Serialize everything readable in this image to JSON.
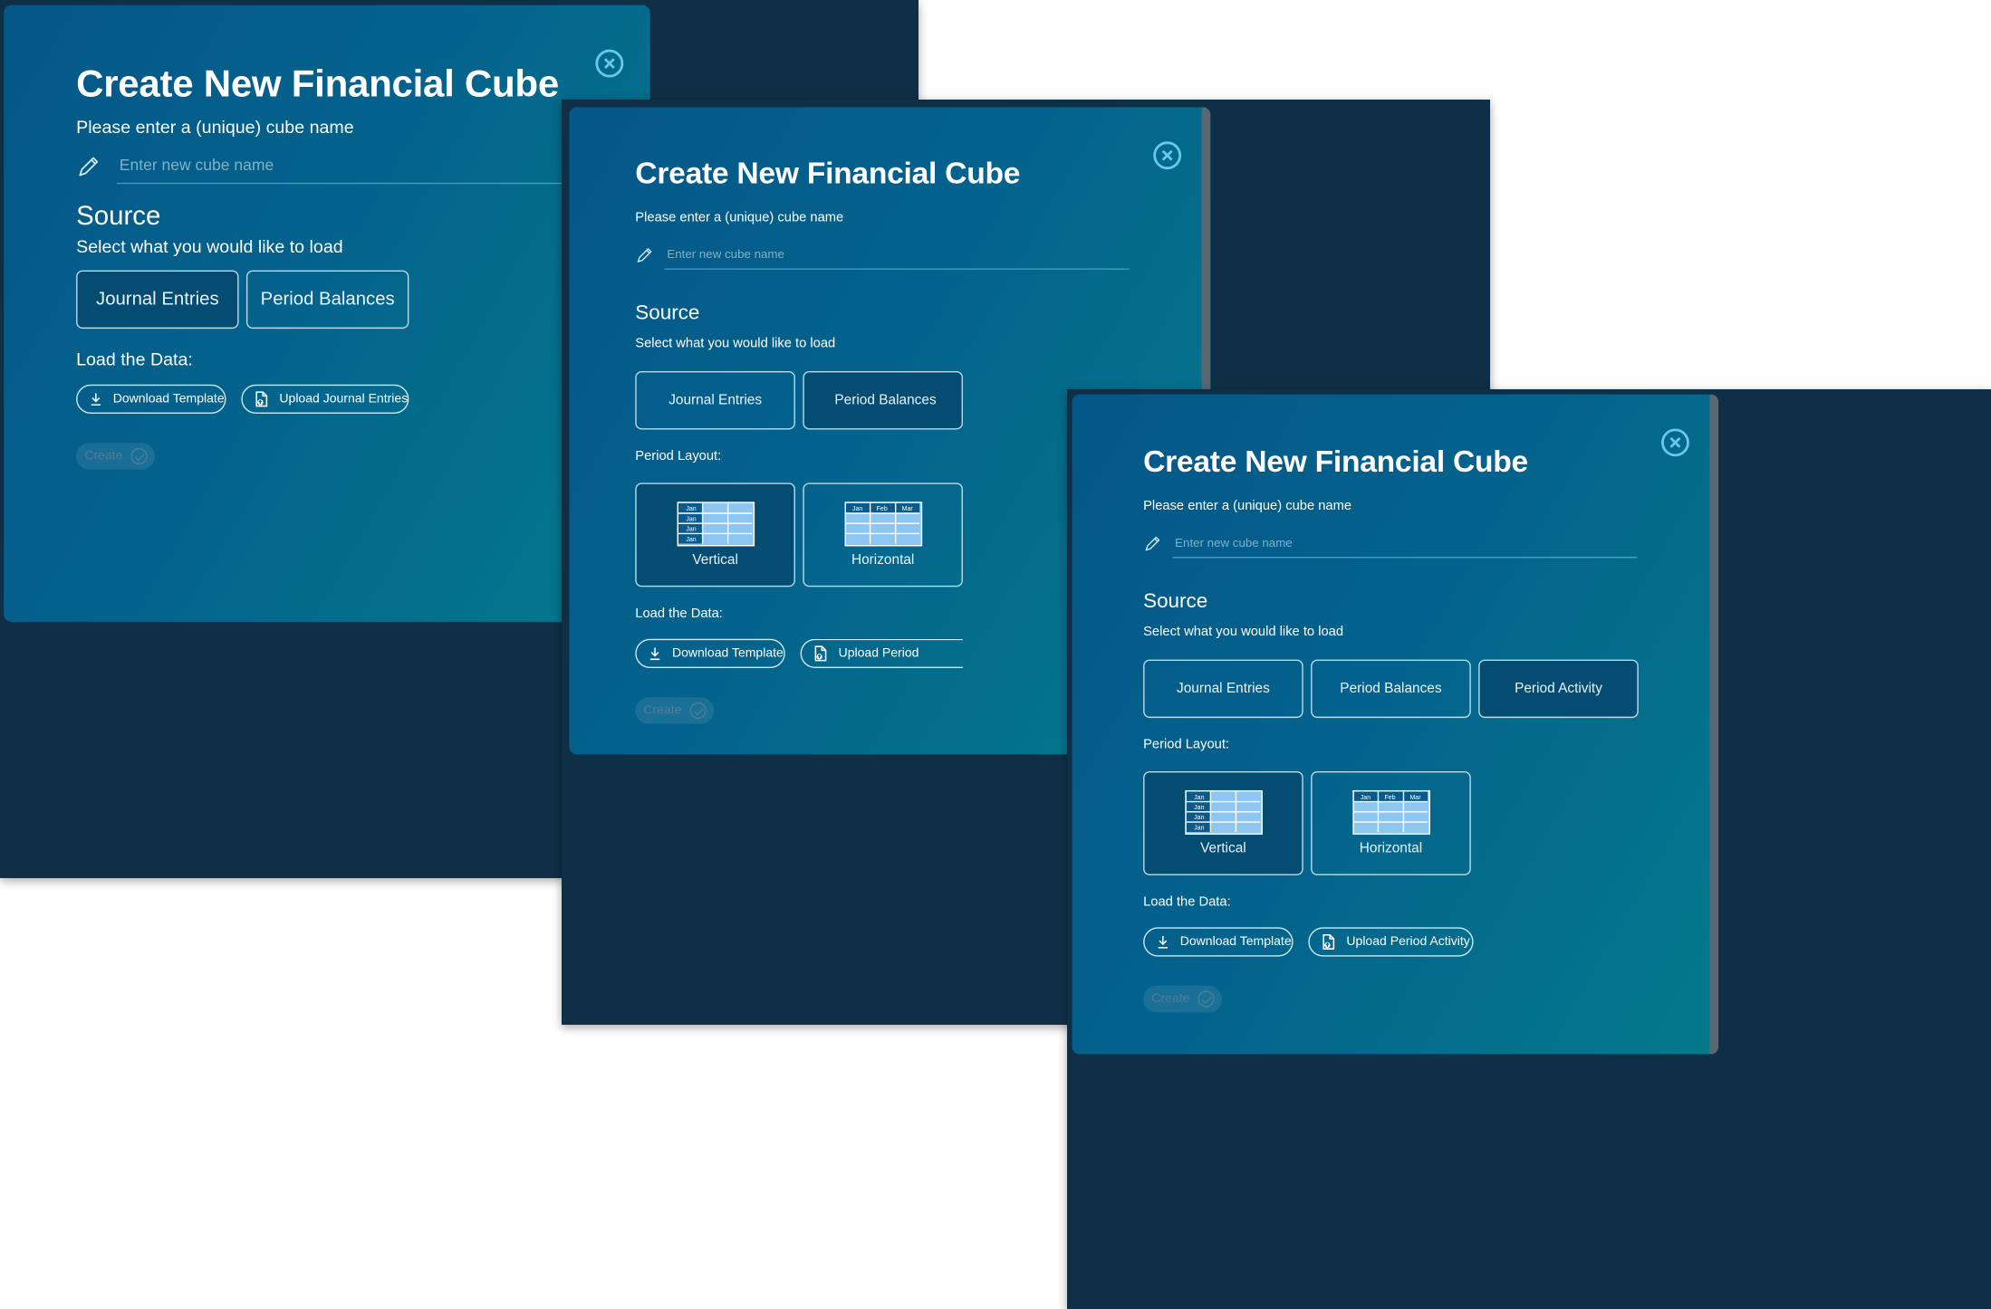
{
  "dialog": {
    "title": "Create New Financial Cube",
    "name_prompt": "Please enter a (unique) cube name",
    "name_placeholder": "Enter new cube name",
    "source_heading": "Source",
    "source_prompt": "Select what you would like to load",
    "period_layout_label": "Period Layout:",
    "load_label": "Load the Data:",
    "create_label": "Create"
  },
  "source_options": {
    "journal": "Journal Entries",
    "balances": "Period Balances",
    "activity": "Period Activity"
  },
  "layouts": {
    "vertical": "Vertical",
    "horizontal": "Horizontal"
  },
  "grid_labels": {
    "jan": "Jan",
    "feb": "Feb",
    "mar": "Mar"
  },
  "actions": {
    "download_template": "Download Template",
    "upload_journal": "Upload Journal Entries",
    "upload_period": "Upload Period",
    "upload_period_activity": "Upload Period Activity"
  },
  "selected": {
    "shot1_source": "Journal Entries",
    "shot2_source": "Period Balances",
    "shot2_layout": "Vertical",
    "shot3_source": "Period Activity",
    "shot3_layout": "Vertical"
  },
  "colors": {
    "dialog_gradient_start": "#045788",
    "dialog_gradient_end": "#047a8c",
    "selected_fill": "#044c72",
    "close_icon": "#6cc7ee",
    "grid_fill": "#8ec6f2",
    "grid_header": "#0a5a8c"
  }
}
